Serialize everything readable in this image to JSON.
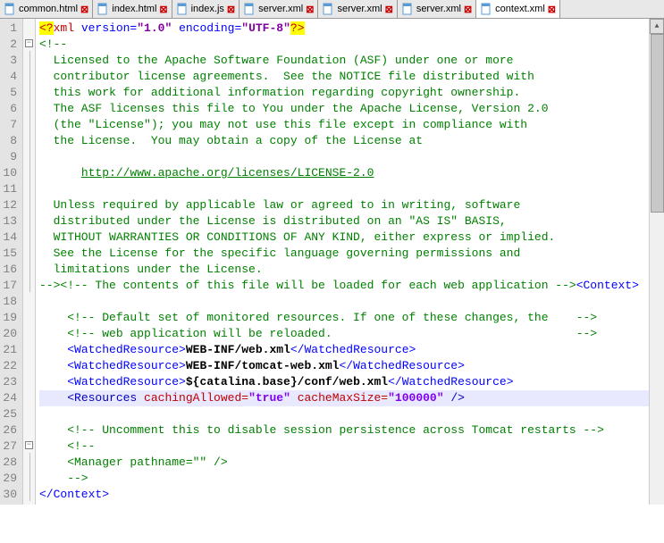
{
  "tabs": [
    {
      "label": "common.html",
      "active": false
    },
    {
      "label": "index.html",
      "active": false
    },
    {
      "label": "index.js",
      "active": false
    },
    {
      "label": "server.xml",
      "active": false
    },
    {
      "label": "server.xml",
      "active": false
    },
    {
      "label": "server.xml",
      "active": false
    },
    {
      "label": "context.xml",
      "active": true
    }
  ],
  "lineNumbers": [
    "1",
    "2",
    "3",
    "4",
    "5",
    "6",
    "7",
    "8",
    "9",
    "10",
    "11",
    "12",
    "13",
    "14",
    "15",
    "16",
    "17",
    "18",
    "19",
    "20",
    "21",
    "22",
    "23",
    "24",
    "25",
    "26",
    "27",
    "28",
    "29",
    "30"
  ],
  "code": {
    "l1": {
      "pre": "<?",
      "xml": "xml ",
      "v": "version=",
      "vv": "\"1.0\"",
      "e": " encoding=",
      "ev": "\"UTF-8\"",
      "post": "?>"
    },
    "l2": "<!--",
    "l3": "  Licensed to the Apache Software Foundation (ASF) under one or more",
    "l4": "  contributor license agreements.  See the NOTICE file distributed with",
    "l5": "  this work for additional information regarding copyright ownership.",
    "l6": "  The ASF licenses this file to You under the Apache License, Version 2.0",
    "l7": "  (the \"License\"); you may not use this file except in compliance with",
    "l8": "  the License.  You may obtain a copy of the License at",
    "l9": "",
    "l10pre": "      ",
    "l10link": "http://www.apache.org/licenses/LICENSE-2.0",
    "l11": "",
    "l12": "  Unless required by applicable law or agreed to in writing, software",
    "l13": "  distributed under the License is distributed on an \"AS IS\" BASIS,",
    "l14": "  WITHOUT WARRANTIES OR CONDITIONS OF ANY KIND, either express or implied.",
    "l15": "  See the License for the specific language governing permissions and",
    "l16": "  limitations under the License.",
    "l17a": "-->",
    "l17b": "<!-- The contents of this file will be loaded for each web application -->",
    "l17c": "<Context>",
    "l18": "",
    "l19": "    <!-- Default set of monitored resources. If one of these changes, the    -->",
    "l20": "    <!-- web application will be reloaded.                                   -->",
    "l21": {
      "o": "<WatchedResource>",
      "t": "WEB-INF/web.xml",
      "c": "</WatchedResource>"
    },
    "l22": {
      "o": "<WatchedResource>",
      "t": "WEB-INF/tomcat-web.xml",
      "c": "</WatchedResource>"
    },
    "l23": {
      "o": "<WatchedResource>",
      "t": "${catalina.base}/conf/web.xml",
      "c": "</WatchedResource>"
    },
    "l24": {
      "o": "<Resources ",
      "a1": "cachingAllowed=",
      "v1": "\"true\"",
      "a2": " cacheMaxSize=",
      "v2": "\"100000\"",
      "c": " />"
    },
    "l25": "",
    "l26": "    <!-- Uncomment this to disable session persistence across Tomcat restarts -->",
    "l27": "    <!--",
    "l28": "    <Manager pathname=\"\" />",
    "l29": "    -->",
    "l30": "</Context>",
    "indent4": "    "
  }
}
